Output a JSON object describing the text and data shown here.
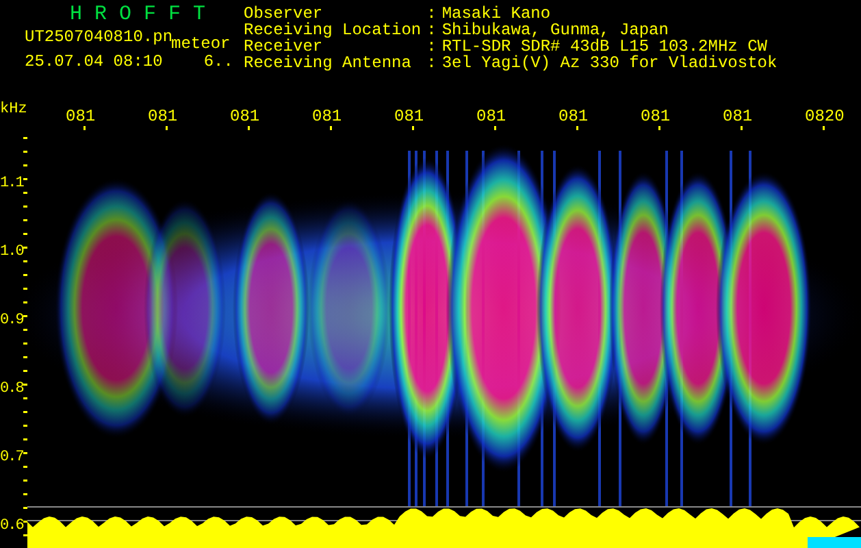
{
  "header": {
    "title": "HROFFT",
    "file_name": "UT2507040810.pn",
    "mode": "meteor",
    "timestamp": "25.07.04 08:10",
    "count": "6..",
    "info": [
      {
        "label": "Observer",
        "separator": ":",
        "value": "Masaki Kano"
      },
      {
        "label": "Receiving Location",
        "separator": ":",
        "value": "Shibukawa, Gunma, Japan"
      },
      {
        "label": "Receiver",
        "separator": ":",
        "value": "RTL-SDR SDR# 43dB L15 103.2MHz CW"
      },
      {
        "label": "Receiving Antenna",
        "separator": ":",
        "value": "3el Yagi(V) Az 330 for Vladivostok"
      }
    ]
  },
  "spectrogram": {
    "unit": "kHz",
    "time_labels": [
      "081",
      "081",
      "081",
      "081",
      "081",
      "081",
      "081",
      "081",
      "081",
      "0820"
    ],
    "frequency_labels": [
      "1.1",
      "1.0",
      "0.9",
      "0.8",
      "0.7",
      "0.6"
    ]
  }
}
